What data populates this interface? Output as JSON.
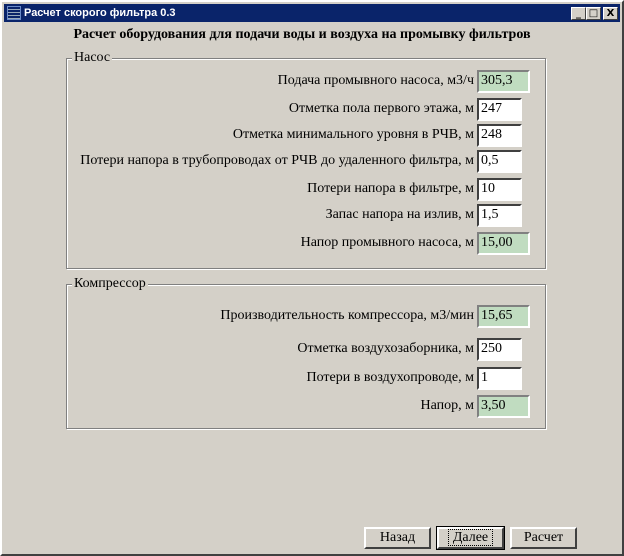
{
  "window": {
    "title": "Расчет скорого фильтра 0.3",
    "min": "_",
    "max": "□",
    "close": "X"
  },
  "heading": "Расчет оборудования для подачи воды и воздуха на промывку фильтров",
  "pump": {
    "title": "Насос",
    "rows": [
      {
        "label": "Подача промывного насоса, м3/ч",
        "value": "305,3",
        "type": "output"
      },
      {
        "label": "Отметка пола первого этажа, м",
        "value": "247",
        "type": "input"
      },
      {
        "label": "Отметка минимального уровня в РЧВ, м",
        "value": "248",
        "type": "input"
      },
      {
        "label": "Потери напора в трубопроводах от РЧВ до удаленного фильтра, м",
        "value": "0,5",
        "type": "input"
      },
      {
        "label": "Потери напора в фильтре, м",
        "value": "10",
        "type": "input"
      },
      {
        "label": "Запас напора на излив, м",
        "value": "1,5",
        "type": "input"
      },
      {
        "label": "Напор промывного насоса, м",
        "value": "15,00",
        "type": "output"
      }
    ]
  },
  "compressor": {
    "title": "Компрессор",
    "rows": [
      {
        "label": "Производительность компрессора, м3/мин",
        "value": "15,65",
        "type": "output"
      },
      {
        "label": "Отметка воздухозаборника, м",
        "value": "250",
        "type": "input"
      },
      {
        "label": "Потери в воздухопроводе, м",
        "value": "1",
        "type": "input"
      },
      {
        "label": "Напор, м",
        "value": "3,50",
        "type": "output"
      }
    ]
  },
  "buttons": {
    "back": "Назад",
    "next": "Далее",
    "calc": "Расчет"
  }
}
